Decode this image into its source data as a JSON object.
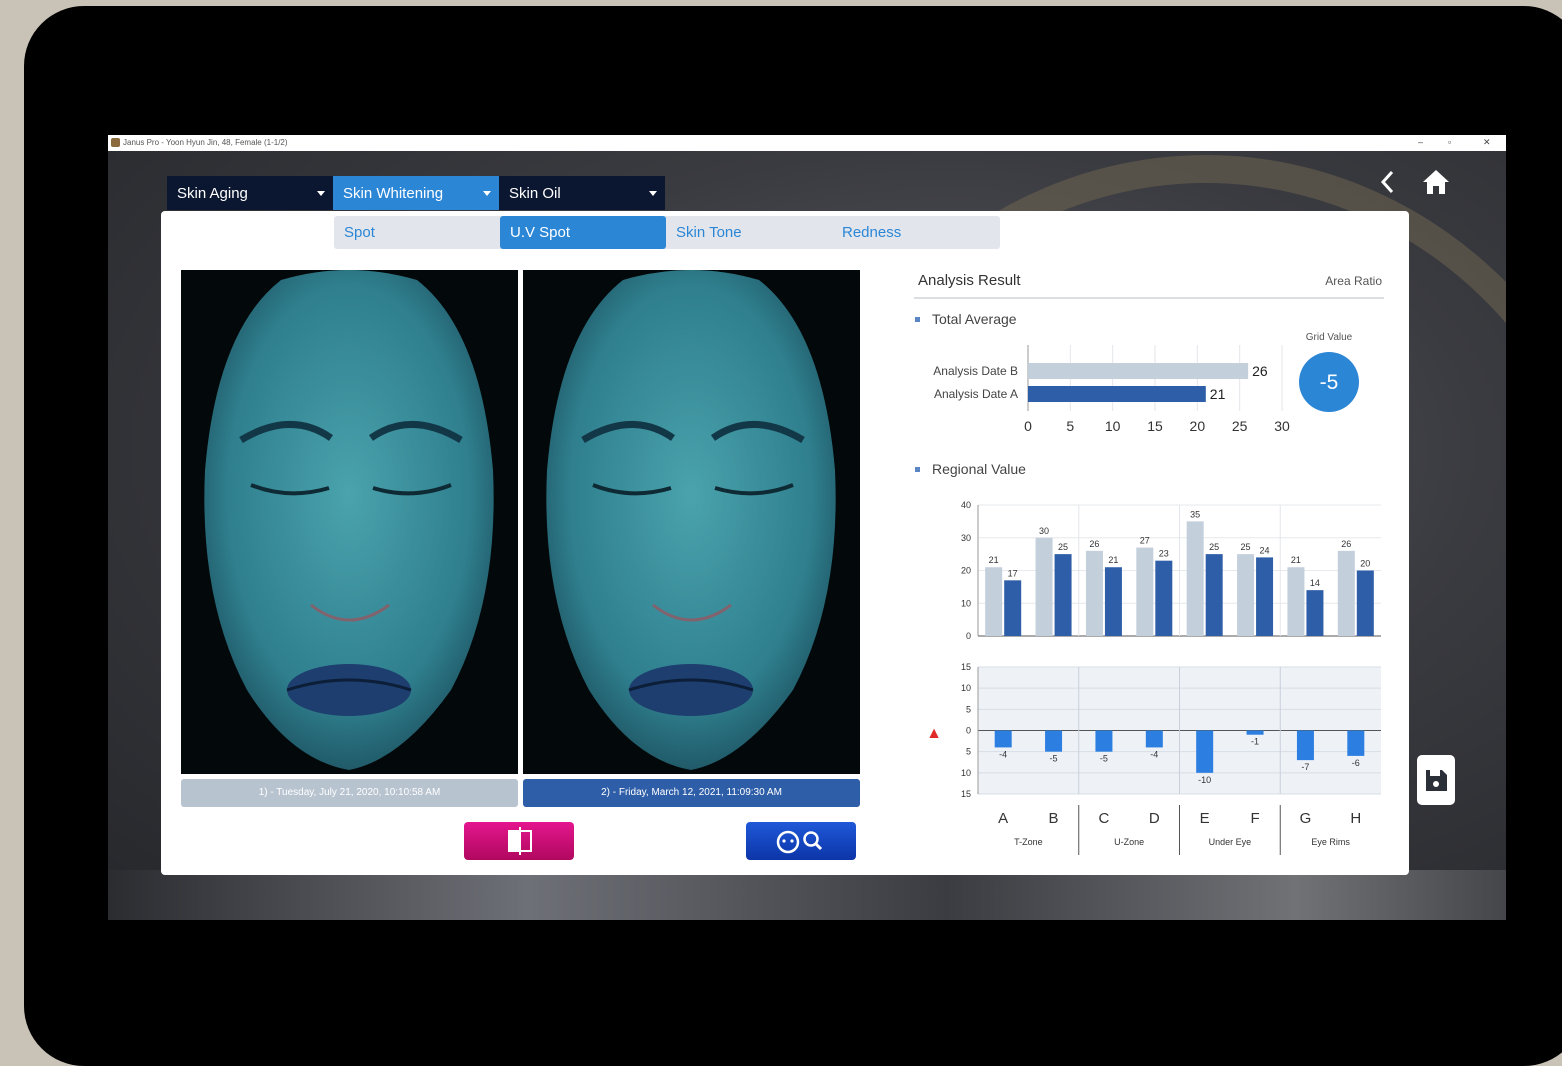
{
  "window": {
    "title": "Janus Pro - Yoon Hyun Jin, 48, Female (1-1/2)",
    "minimize": "–",
    "maximize": "▫",
    "close": "✕"
  },
  "top_tabs": [
    {
      "label": "Skin Aging",
      "active": false
    },
    {
      "label": "Skin Whitening",
      "active": true
    },
    {
      "label": "Skin Oil",
      "active": false
    }
  ],
  "sub_tabs": [
    {
      "label": "Spot",
      "active": false
    },
    {
      "label": "U.V Spot",
      "active": true
    },
    {
      "label": "Skin Tone",
      "active": false
    },
    {
      "label": "Redness",
      "active": false
    }
  ],
  "photos": {
    "left_date": "1) - Tuesday, July 21, 2020, 10:10:58 AM",
    "right_date": "2) - Friday, March 12, 2021, 11:09:30 AM"
  },
  "colors": {
    "accent": "#2b86d6",
    "date_a": "#c4cfdc",
    "date_b": "#2f5ea8",
    "compare_button": "#d1127f",
    "zoom_button": "#1846c8"
  },
  "icons": {
    "back": "chevron-left-icon",
    "home": "home-icon",
    "compare": "split-compare-icon",
    "zoom": "face-zoom-icon",
    "save": "save-icon",
    "sort": "sort-updown-icon"
  },
  "analysis": {
    "title": "Analysis Result",
    "mode": "Area Ratio",
    "total_average_label": "Total Average",
    "grid_value_label": "Grid Value",
    "grid_value": "-5",
    "regional_label": "Regional Value"
  },
  "chart_data": [
    {
      "type": "bar",
      "orientation": "horizontal",
      "categories": [
        "Analysis Date B",
        "Analysis Date A"
      ],
      "values": [
        26,
        21
      ],
      "xlim": [
        0,
        30
      ],
      "xticks": [
        0,
        5,
        10,
        15,
        20,
        25,
        30
      ],
      "grid": true
    },
    {
      "type": "bar",
      "categories": [
        "A",
        "B",
        "C",
        "D",
        "E",
        "F",
        "G",
        "H"
      ],
      "groups": [
        "T-Zone",
        "U-Zone",
        "Under Eye",
        "Eye Rims"
      ],
      "series": [
        {
          "values": [
            21,
            30,
            26,
            27,
            35,
            25,
            21,
            26
          ]
        },
        {
          "values": [
            17,
            25,
            21,
            23,
            25,
            24,
            14,
            20
          ]
        }
      ],
      "ylim": [
        0,
        40
      ],
      "yticks": [
        0,
        10,
        20,
        30,
        40
      ],
      "grid": true
    },
    {
      "type": "bar",
      "categories": [
        "A",
        "B",
        "C",
        "D",
        "E",
        "F",
        "G",
        "H"
      ],
      "values": [
        -4,
        -5,
        -5,
        -4,
        -10,
        -1,
        -7,
        -6
      ],
      "ylim": [
        -15,
        15
      ],
      "yticks": [
        15,
        10,
        5,
        0,
        5,
        10,
        15
      ],
      "grid": true
    }
  ]
}
